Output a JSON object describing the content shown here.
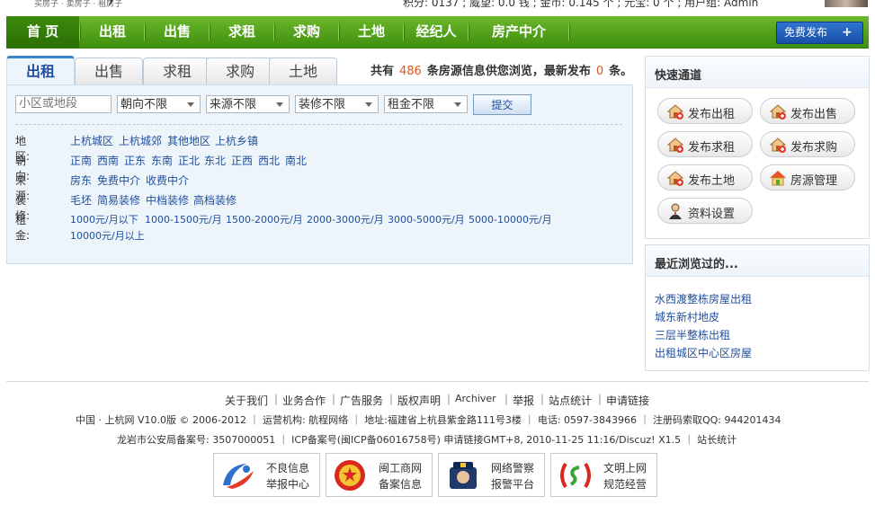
{
  "top": {
    "slogan": "买房子 · 卖房子 · 租房子",
    "user_stats": "积分: 0137 ; 威望: 0.0 钱 ; 金币: 0.145 个 ; 元宝: 0 个 ; 用户组: Admin"
  },
  "nav": {
    "items": [
      "首 页",
      "出租",
      "出售",
      "求租",
      "求购",
      "土地",
      "经纪人",
      "房产中介"
    ],
    "free_publish": "免费发布",
    "free_publish_plus": "+"
  },
  "tabs": [
    "出租",
    "出售",
    "求租",
    "求购",
    "土地"
  ],
  "count_line": {
    "prefix": "共有",
    "total": "486",
    "middle": "条房源信息供您浏览，最新发布",
    "latest": "0",
    "suffix": "条。"
  },
  "filters": {
    "search_placeholder": "小区或地段",
    "orientation": "朝向不限",
    "source": "来源不限",
    "decoration": "装修不限",
    "rent": "租金不限",
    "submit": "提交"
  },
  "filter_rows": {
    "region": {
      "label": "地区:",
      "options": [
        "上杭城区",
        "上杭城郊",
        "其他地区",
        "上杭乡镇"
      ]
    },
    "orientation": {
      "label": "朝向:",
      "options": [
        "正南",
        "西南",
        "正东",
        "东南",
        "正北",
        "东北",
        "正西",
        "西北",
        "南北"
      ]
    },
    "source": {
      "label": "来源:",
      "options": [
        "房东",
        "免费中介",
        "收费中介"
      ]
    },
    "decoration": {
      "label": "装修:",
      "options": [
        "毛坯",
        "简易装修",
        "中档装修",
        "高档装修"
      ]
    },
    "rent": {
      "label": "租金:",
      "options": [
        "1000元/月以下",
        "1000-1500元/月",
        "1500-2000元/月",
        "2000-3000元/月",
        "3000-5000元/月",
        "5000-10000元/月",
        "10000元/月以上"
      ]
    }
  },
  "quick": {
    "title": "快速通道",
    "buttons": [
      "发布出租",
      "发布出售",
      "发布求租",
      "发布求购",
      "发布土地",
      "房源管理",
      "资料设置"
    ]
  },
  "recent": {
    "title": "最近浏览过的...",
    "items": [
      "水西渡整栋房屋出租",
      "城东新村地皮",
      "三层半整栋出租",
      "出租城区中心区房屋"
    ]
  },
  "footer": {
    "links": [
      "关于我们",
      "业务合作",
      "广告服务",
      "版权声明",
      "Archiver",
      "举报",
      "站点统计",
      "申请链接"
    ],
    "line2": "中国 · 上杭网 V10.0版 © 2006-2012 ｜ 运营机构: 航程网络 ｜ 地址:福建省上杭县紫金路111号3楼 ｜ 电话: 0597-3843966 ｜ 注册码索取QQ: 944201434",
    "line3": "龙岩市公安局备案号: 3507000051 ｜ ICP备案号(闽ICP备06016758号) 申请链接GMT+8, 2010-11-25 11:16/Discuz! X1.5 ｜ 站长统计",
    "badges": [
      {
        "line1": "不良信息",
        "line2": "举报中心"
      },
      {
        "line1": "闽工商网",
        "line2": "备案信息"
      },
      {
        "line1": "网络警察",
        "line2": "报警平台"
      },
      {
        "line1": "文明上网",
        "line2": "规范经营"
      }
    ]
  },
  "colors": {
    "nav_green": "#4a9e17",
    "link_blue": "#1f4e9c",
    "count_orange": "#e0561b"
  }
}
